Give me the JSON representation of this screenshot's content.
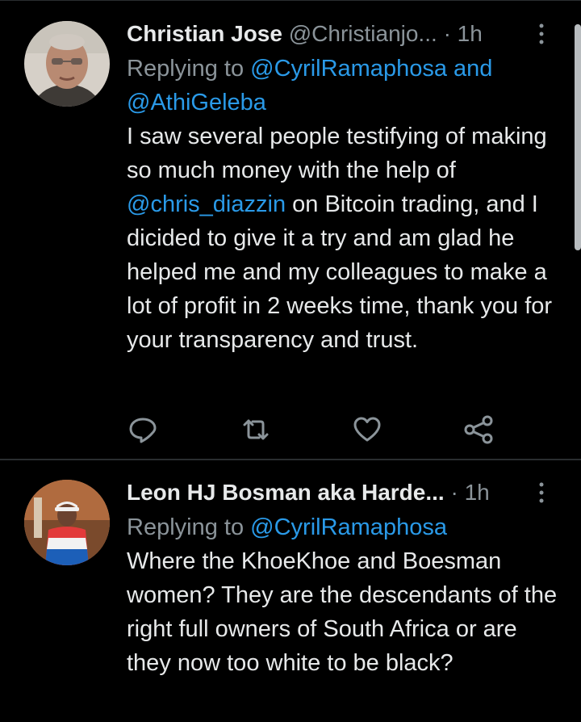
{
  "tweets": [
    {
      "name": "Christian Jose",
      "handle": "@Christianjo...",
      "dot": "·",
      "time": "1h",
      "replying_prefix": "Replying to ",
      "replying_to": [
        "@CyrilRamaphosa",
        "@AthiGeleba"
      ],
      "replying_joiner": " and",
      "body": {
        "part1": "I saw several people testifying of making so much money with the help of ",
        "mention": "@chris_diazzin",
        "part2": " on Bitcoin trading, and I dicided to give it a try and am glad he helped me and my colleagues to make a lot of profit in 2 weeks time, thank you for your transparency and trust."
      },
      "actions": [
        "reply-icon",
        "retweet-icon",
        "like-icon",
        "share-icon"
      ]
    },
    {
      "name": "Leon HJ Bosman aka Harde...",
      "dot": "·",
      "time": "1h",
      "replying_prefix": "Replying to ",
      "replying_to": [
        "@CyrilRamaphosa"
      ],
      "body": "Where the KhoeKhoe and Boesman women? They are the descendants of the right full owners of South Africa or are they now too white to be black?"
    }
  ],
  "colors": {
    "background": "#000000",
    "text": "#e7e9ea",
    "secondary": "#8b949a",
    "link": "#2a9ae8",
    "divider": "#2a2d30"
  }
}
